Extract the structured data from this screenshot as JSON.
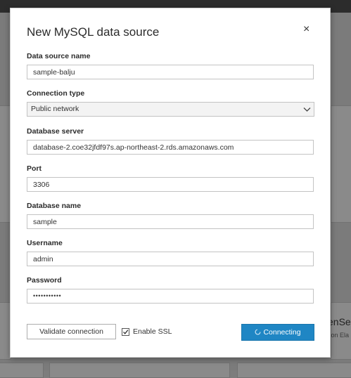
{
  "dialog": {
    "title": "New MySQL data source",
    "close_icon": "×"
  },
  "fields": {
    "data_source_name": {
      "label": "Data source name",
      "value": "sample-balju"
    },
    "connection_type": {
      "label": "Connection type",
      "value": "Public network"
    },
    "database_server": {
      "label": "Database server",
      "value": "database-2.coe32jfdf97s.ap-northeast-2.rds.amazonaws.com"
    },
    "port": {
      "label": "Port",
      "value": "3306"
    },
    "database_name": {
      "label": "Database name",
      "value": "sample"
    },
    "username": {
      "label": "Username",
      "value": "admin"
    },
    "password": {
      "label": "Password",
      "value": "•••••••••••"
    }
  },
  "footer": {
    "validate_label": "Validate connection",
    "ssl_label": "Enable SSL",
    "ssl_checked": true,
    "connect_label": "Connecting"
  },
  "background": {
    "peek_text": "enSe",
    "peek_sub": "zon Ela"
  },
  "icons": {
    "close": "close-icon",
    "chevron": "chevron-down-icon",
    "check": "check-icon",
    "spinner": "spinner-icon"
  },
  "colors": {
    "primary": "#1f86c4",
    "overlay": "#7b7b7b",
    "topbar": "#2c2c2c"
  }
}
